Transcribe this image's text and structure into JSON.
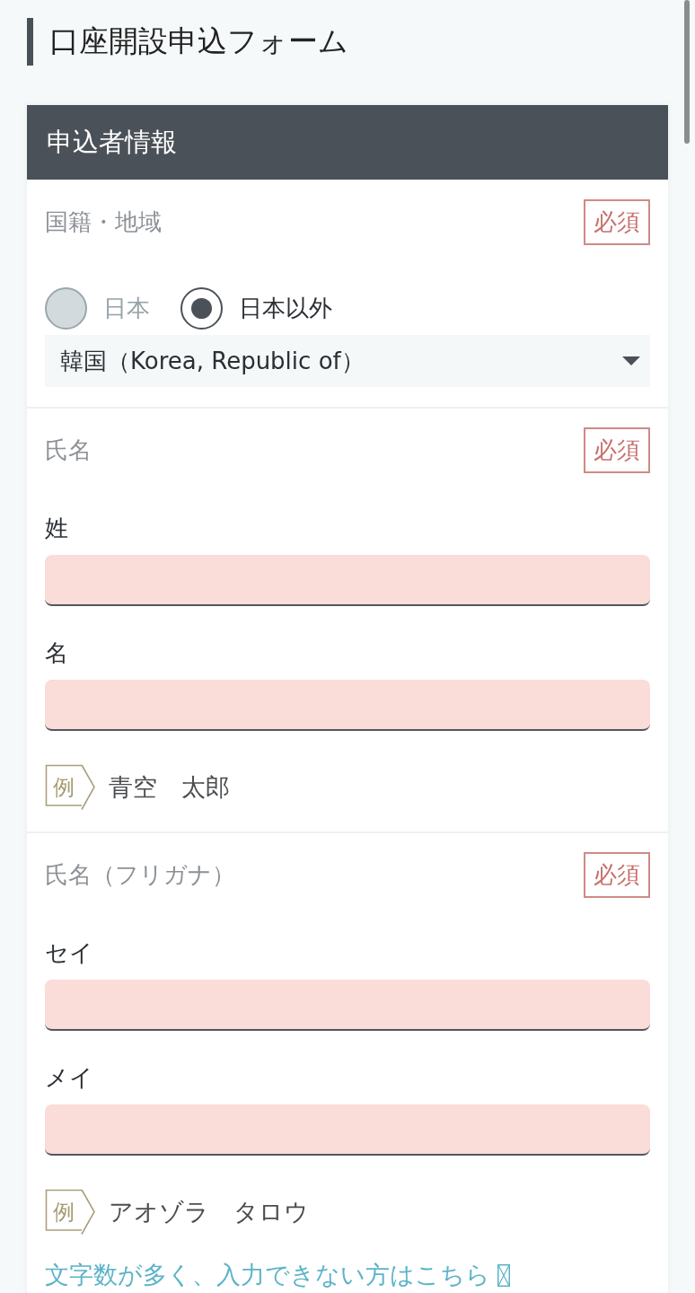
{
  "page_title": "口座開設申込フォーム",
  "panel": {
    "title": "申込者情報",
    "fields": [
      {
        "kind": "choice",
        "label": "国籍・地域",
        "badge": "必須",
        "options": [
          {
            "label": "日本",
            "selected": false
          },
          {
            "label": "日本以外",
            "selected": true
          }
        ],
        "select": {
          "value": "韓国（Korea, Republic of）"
        }
      },
      {
        "kind": "text_inputs",
        "label": "氏名",
        "badge": "必須",
        "inputs": [
          {
            "label": "姓"
          },
          {
            "label": "名"
          }
        ],
        "example": {
          "tag": "例",
          "text": "青空　太郎"
        }
      },
      {
        "kind": "text_inputs",
        "label": "氏名（フリガナ）",
        "badge": "必須",
        "inputs": [
          {
            "label": "セイ"
          },
          {
            "label": "メイ"
          }
        ],
        "example": {
          "tag": "例",
          "text": "アオゾラ　タロウ"
        },
        "link": {
          "text": "文字数が多く、入力できない方はこちら"
        }
      }
    ]
  }
}
